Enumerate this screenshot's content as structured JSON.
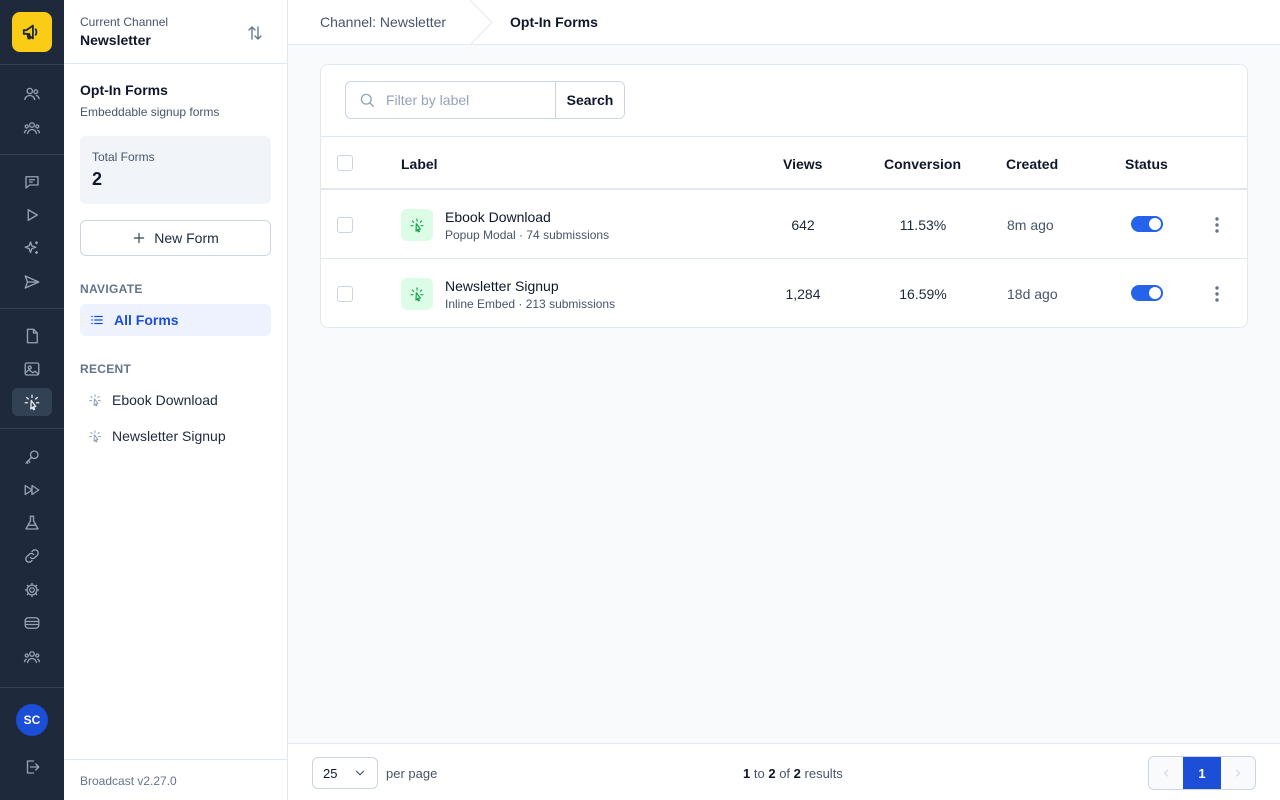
{
  "sidebar": {
    "channel_label": "Current Channel",
    "channel_name": "Newsletter",
    "section_title": "Opt-In Forms",
    "section_subtitle": "Embeddable signup forms",
    "stat_label": "Total Forms",
    "stat_value": "2",
    "new_form_label": "New Form",
    "navigate_heading": "NAVIGATE",
    "nav_items": [
      {
        "label": "All Forms",
        "active": true
      }
    ],
    "recent_heading": "RECENT",
    "recent_items": [
      {
        "label": "Ebook Download"
      },
      {
        "label": "Newsletter Signup"
      }
    ],
    "version": "Broadcast v2.27.0"
  },
  "rail": {
    "avatar_initials": "SC",
    "icons": [
      "users-icon",
      "groups-icon",
      "messages-icon",
      "play-icon",
      "sparkles-icon",
      "send-icon",
      "document-icon",
      "image-icon",
      "cursor-click-icon",
      "key-icon",
      "fast-forward-icon",
      "flask-icon",
      "link-icon",
      "gear-icon",
      "database-icon",
      "team-icon",
      "logout-icon"
    ],
    "active_icon": "cursor-click-icon"
  },
  "breadcrumb": {
    "items": [
      "Channel: Newsletter",
      "Opt-In Forms"
    ]
  },
  "search": {
    "placeholder": "Filter by label",
    "button_label": "Search"
  },
  "table": {
    "columns": {
      "label": "Label",
      "views": "Views",
      "conversion": "Conversion",
      "created": "Created",
      "status": "Status"
    },
    "rows": [
      {
        "name": "Ebook Download",
        "meta": "Popup Modal · 74 submissions",
        "views": "642",
        "conversion": "11.53%",
        "created": "8m ago",
        "enabled": true
      },
      {
        "name": "Newsletter Signup",
        "meta": "Inline Embed · 213 submissions",
        "views": "1,284",
        "conversion": "16.59%",
        "created": "18d ago",
        "enabled": true
      }
    ]
  },
  "footer": {
    "per_page_value": "25",
    "per_page_label": "per page",
    "results_from": "1",
    "results_to_word": "to",
    "results_to": "2",
    "results_of_word": "of",
    "results_total": "2",
    "results_word": "results",
    "current_page": "1"
  },
  "colors": {
    "accent": "#1d4ed8",
    "rail_bg": "#1e293b",
    "logo_bg": "#facc15",
    "toggle_on": "#2563eb",
    "form_icon_bg": "#dcfce7"
  }
}
